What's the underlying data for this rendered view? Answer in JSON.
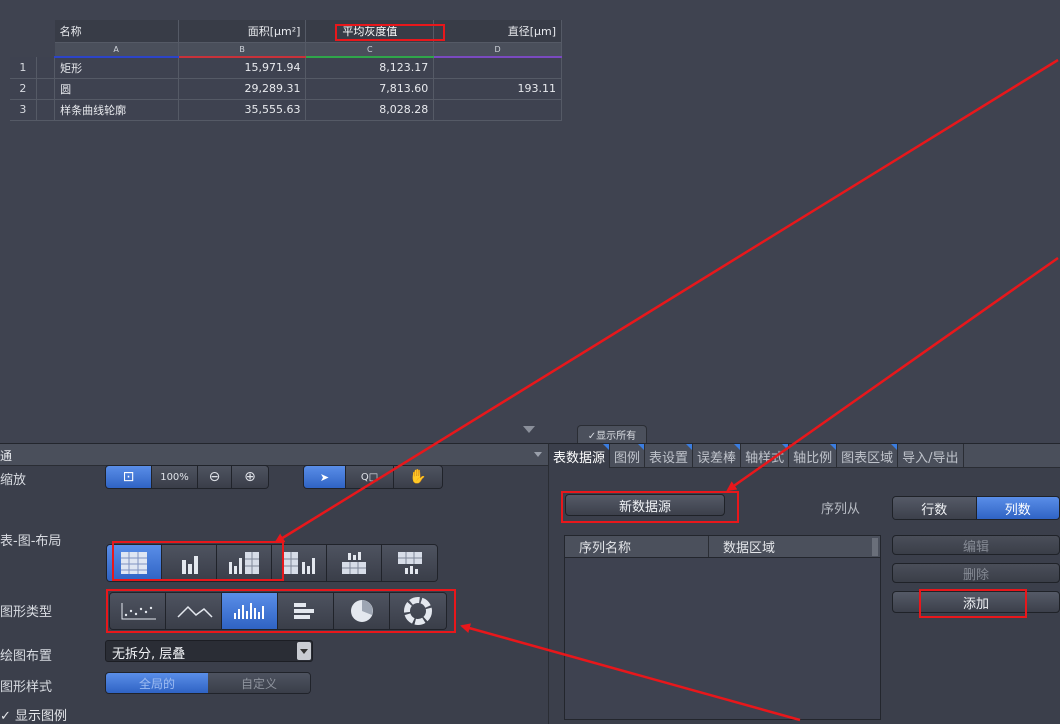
{
  "table": {
    "headers": [
      "名称",
      "面积[µm²]",
      "平均灰度值",
      "直径[µm]"
    ],
    "column_letters": [
      "A",
      "B",
      "C",
      "D"
    ],
    "rows": [
      {
        "num": "1",
        "name": "矩形",
        "area": "15,971.94",
        "gray": "8,123.17",
        "diameter": ""
      },
      {
        "num": "2",
        "name": "圆",
        "area": "29,289.31",
        "gray": "7,813.60",
        "diameter": "193.11"
      },
      {
        "num": "3",
        "name": "样条曲线轮廓",
        "area": "35,555.63",
        "gray": "8,028.28",
        "diameter": ""
      }
    ]
  },
  "left_panel": {
    "title": "通",
    "zoom_label": "缩放",
    "zoom_buttons": [
      "⊡",
      "100%",
      "⊖",
      "⊕",
      "➤",
      "Q□",
      "✋"
    ],
    "layout_label": "表-图-布局",
    "chart_type_label": "图形类型",
    "plot_layout_label": "绘图布置",
    "plot_layout_value": "无拆分, 层叠",
    "chart_style_label": "图形样式",
    "chart_style_options": [
      "全局的",
      "自定义"
    ],
    "show_legend": "✓ 显示图例"
  },
  "right_panel": {
    "show_all": "✓显示所有",
    "tabs": [
      "表数据源",
      "图例",
      "表设置",
      "误差棒",
      "轴样式",
      "轴比例",
      "图表区域",
      "导入/导出"
    ],
    "new_source": "新数据源",
    "series_from": "序列从",
    "row_btn": "行数",
    "col_btn": "列数",
    "series_headers": [
      "序列名称",
      "数据区域"
    ],
    "edit": "编辑",
    "delete": "删除",
    "add": "添加"
  },
  "colors": {
    "background": "#3f4350",
    "accent": "#3a76d8",
    "annotation": "#e8171b"
  }
}
